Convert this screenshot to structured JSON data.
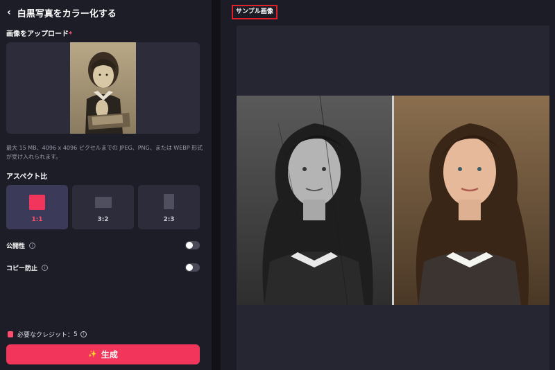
{
  "header": {
    "back_icon": "chevron-left-icon",
    "title": "白黒写真をカラー化する"
  },
  "upload": {
    "label": "画像をアップロード",
    "required_mark": "*",
    "hint": "最大 15 MB、4096 x 4096 ピクセルまでの JPEG、PNG、または WEBP 形式が受け入れられます。"
  },
  "aspect": {
    "label": "アスペクト比",
    "options": [
      {
        "label": "1:1",
        "selected": true
      },
      {
        "label": "3:2",
        "selected": false
      },
      {
        "label": "2:3",
        "selected": false
      }
    ]
  },
  "toggles": [
    {
      "label": "公開性",
      "on": false
    },
    {
      "label": "コピー防止",
      "on": false
    }
  ],
  "credit": {
    "label": "必要なクレジット：",
    "value": "5"
  },
  "generate": {
    "label": "生成",
    "icon": "sparkle-icon"
  },
  "sample": {
    "label": "サンプル画像"
  },
  "colors": {
    "accent": "#f2355b",
    "selected_bg": "#3b3a58",
    "panel": "#2c2c3a",
    "highlight_border": "#e0202a"
  }
}
